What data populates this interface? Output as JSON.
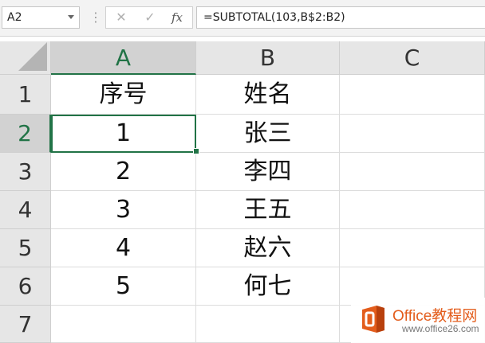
{
  "name_box": {
    "value": "A2"
  },
  "formula_bar": {
    "separator": "⋮",
    "cancel_glyph": "✕",
    "enter_glyph": "✓",
    "fx_label": "fx",
    "formula": "=SUBTOTAL(103,B$2:B2)"
  },
  "columns": [
    "A",
    "B",
    "C"
  ],
  "rows": [
    "1",
    "2",
    "3",
    "4",
    "5",
    "6",
    "7"
  ],
  "cells": [
    {
      "a": "序号",
      "b": "姓名"
    },
    {
      "a": "1",
      "b": "张三"
    },
    {
      "a": "2",
      "b": "李四"
    },
    {
      "a": "3",
      "b": "王五"
    },
    {
      "a": "4",
      "b": "赵六"
    },
    {
      "a": "5",
      "b": "何七"
    },
    {
      "a": "",
      "b": ""
    }
  ],
  "selection": {
    "cell": "A2",
    "column": "A",
    "row": "2"
  },
  "watermark": {
    "text": "Office教程网",
    "subtext": "www.office26.com",
    "brand_color": "#e35d1c"
  },
  "colors": {
    "accent": "#217346",
    "header_bg": "#e6e6e6",
    "grid": "#dcdcdc"
  }
}
